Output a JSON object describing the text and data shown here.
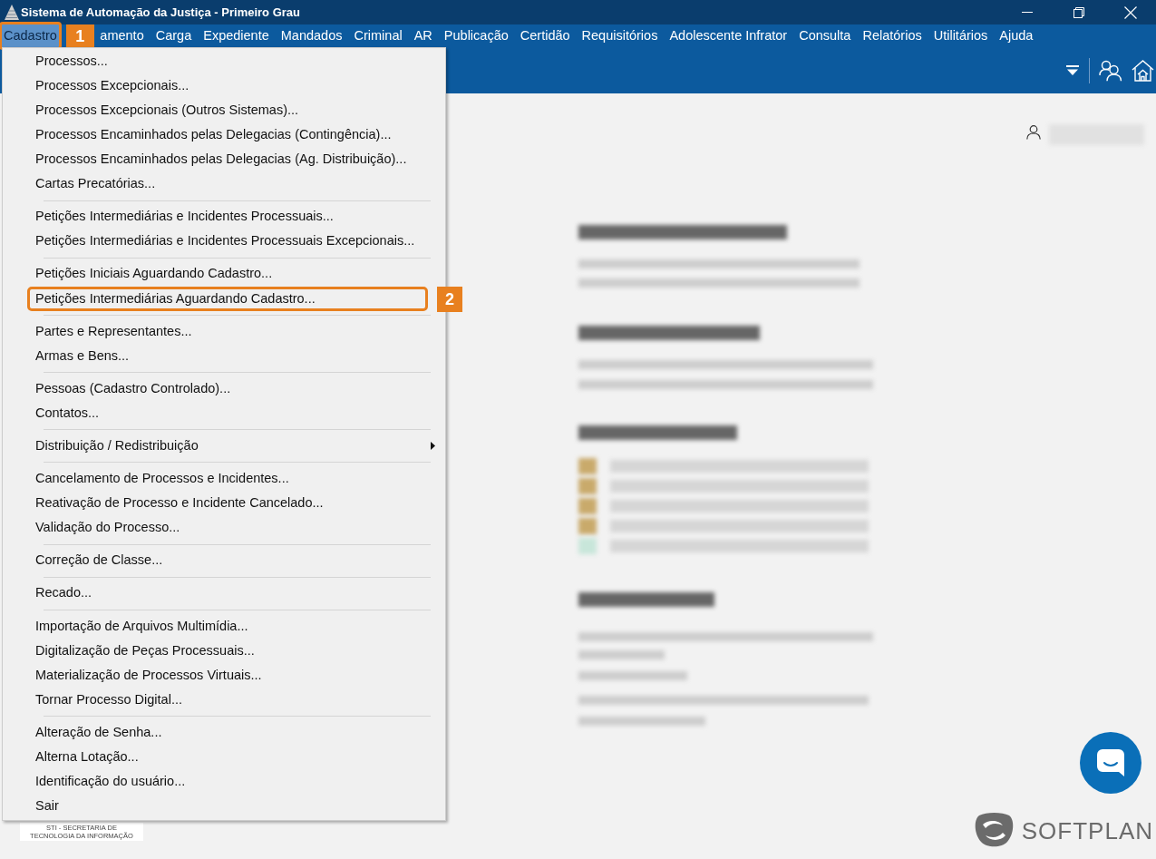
{
  "window": {
    "title": "Sistema de Automação da Justiça - Primeiro Grau"
  },
  "menubar": [
    {
      "label": "Cadastro",
      "selected": true,
      "callout": "1"
    },
    {
      "label": "amento",
      "selected": false
    },
    {
      "label": "Carga",
      "selected": false
    },
    {
      "label": "Expediente",
      "selected": false
    },
    {
      "label": "Mandados",
      "selected": false
    },
    {
      "label": "Criminal",
      "selected": false
    },
    {
      "label": "AR",
      "selected": false
    },
    {
      "label": "Publicação",
      "selected": false
    },
    {
      "label": "Certidão",
      "selected": false
    },
    {
      "label": "Requisitórios",
      "selected": false
    },
    {
      "label": "Adolescente Infrator",
      "selected": false
    },
    {
      "label": "Consulta",
      "selected": false
    },
    {
      "label": "Relatórios",
      "selected": false
    },
    {
      "label": "Utilitários",
      "selected": false
    },
    {
      "label": "Ajuda",
      "selected": false
    }
  ],
  "menu": {
    "sections": [
      {
        "items": [
          {
            "label": "Processos...",
            "submenu": false
          },
          {
            "label": "Processos Excepcionais...",
            "submenu": false
          },
          {
            "label": "Processos Excepcionais (Outros Sistemas)...",
            "submenu": false
          },
          {
            "label": "Processos Encaminhados pelas Delegacias (Contingência)...",
            "submenu": false
          },
          {
            "label": "Processos Encaminhados pelas Delegacias (Ag. Distribuição)...",
            "submenu": false
          },
          {
            "label": "Cartas Precatórias...",
            "submenu": false
          }
        ]
      },
      {
        "items": [
          {
            "label": "Petições Intermediárias e Incidentes Processuais...",
            "submenu": false
          },
          {
            "label": "Petições Intermediárias e Incidentes Processuais Excepcionais...",
            "submenu": false
          }
        ]
      },
      {
        "items": [
          {
            "label": "Petições Iniciais Aguardando Cadastro...",
            "submenu": false
          },
          {
            "label": "Petições Intermediárias Aguardando Cadastro...",
            "submenu": false,
            "callout": "2"
          }
        ]
      },
      {
        "items": [
          {
            "label": "Partes e Representantes...",
            "submenu": false
          },
          {
            "label": "Armas e Bens...",
            "submenu": false
          }
        ]
      },
      {
        "items": [
          {
            "label": "Pessoas (Cadastro Controlado)...",
            "submenu": false
          },
          {
            "label": "Contatos...",
            "submenu": false
          }
        ]
      },
      {
        "items": [
          {
            "label": "Distribuição / Redistribuição",
            "submenu": true
          }
        ]
      },
      {
        "items": [
          {
            "label": "Cancelamento de Processos e Incidentes...",
            "submenu": false
          },
          {
            "label": "Reativação de Processo e Incidente Cancelado...",
            "submenu": false
          },
          {
            "label": "Validação do Processo...",
            "submenu": false
          }
        ]
      },
      {
        "items": [
          {
            "label": "Correção de Classe...",
            "submenu": false
          }
        ]
      },
      {
        "items": [
          {
            "label": "Recado...",
            "submenu": false
          }
        ]
      },
      {
        "items": [
          {
            "label": "Importação de Arquivos Multimídia...",
            "submenu": false
          },
          {
            "label": "Digitalização de Peças Processuais...",
            "submenu": false
          },
          {
            "label": "Materialização de Processos Virtuais...",
            "submenu": false
          },
          {
            "label": "Tornar Processo Digital...",
            "submenu": false
          }
        ]
      },
      {
        "items": [
          {
            "label": "Alteração de Senha...",
            "submenu": false
          },
          {
            "label": "Alterna Lotação...",
            "submenu": false
          },
          {
            "label": "Identificação do usuário...",
            "submenu": false
          },
          {
            "label": "Sair",
            "submenu": false
          }
        ]
      }
    ]
  },
  "footer": {
    "sti_logo": {
      "lines": [
        "STI - SECRETARIA DE",
        "TECNOLOGIA DA INFORMAÇÃO"
      ]
    },
    "brand": "SOFTPLAN"
  }
}
